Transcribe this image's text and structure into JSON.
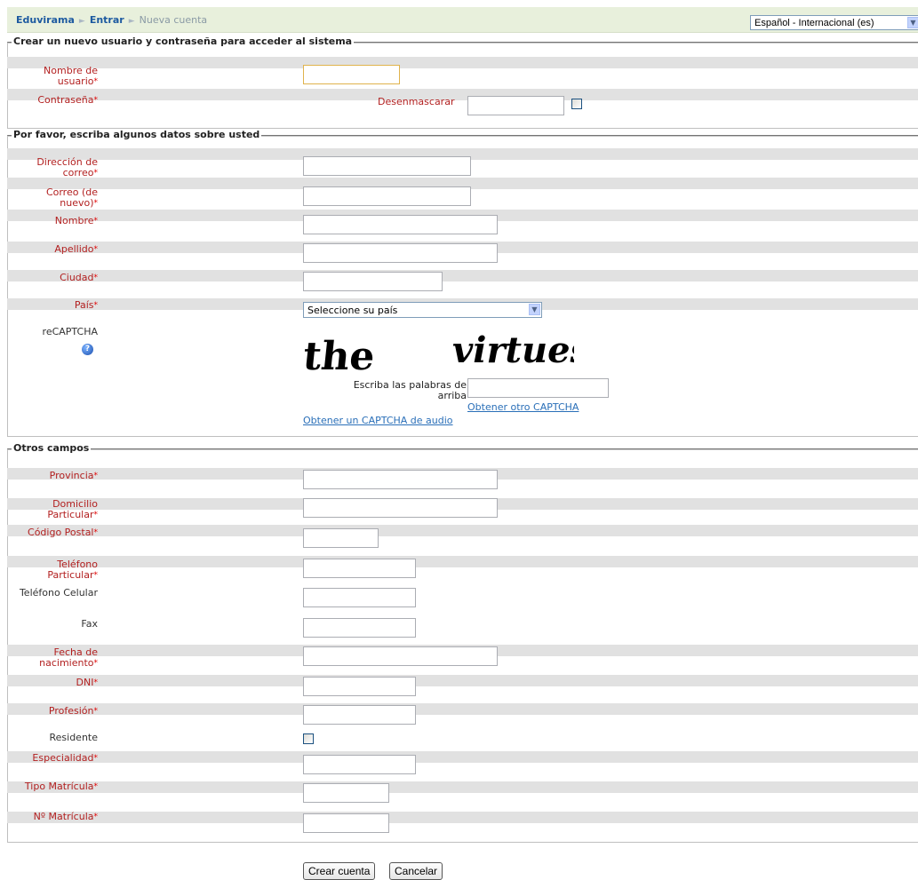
{
  "breadcrumb": {
    "site": "Eduvirama",
    "login": "Entrar",
    "current": "Nueva cuenta",
    "separator": "►"
  },
  "language": {
    "selected": "Español - Internacional (es)"
  },
  "sections": {
    "account": "Crear un nuevo usuario y contraseña para acceder al sistema",
    "about": "Por favor, escriba algunos datos sobre usted",
    "other": "Otros campos"
  },
  "fields": {
    "username": "Nombre de usuario",
    "password": "Contraseña",
    "unmask": "Desenmascarar",
    "email": "Dirección de correo",
    "email2": "Correo (de nuevo)",
    "firstname": "Nombre",
    "lastname": "Apellido",
    "city": "Ciudad",
    "country": "País",
    "recaptcha": "reCAPTCHA",
    "provincia": "Provincia",
    "domicilio": "Domicilio Particular",
    "cp": "Código Postal",
    "tel": "Teléfono Particular",
    "cel": "Teléfono Celular",
    "fax": "Fax",
    "fecha": "Fecha de nacimiento",
    "dni": "DNI",
    "profesion": "Profesión",
    "residente": "Residente",
    "especialidad": "Especialidad",
    "tipo_matricula": "Tipo Matrícula",
    "nro_matricula": "Nº Matrícula"
  },
  "country_select": {
    "value": "Seleccione su país"
  },
  "captcha": {
    "word1": "the",
    "word2": "virtues",
    "prompt": "Escriba las palabras de arriba",
    "other_link": "Obtener otro CAPTCHA",
    "audio_link": "Obtener un CAPTCHA de audio"
  },
  "required_mark": "*",
  "help_glyph": "?",
  "buttons": {
    "submit": "Crear cuenta",
    "cancel": "Cancelar"
  }
}
